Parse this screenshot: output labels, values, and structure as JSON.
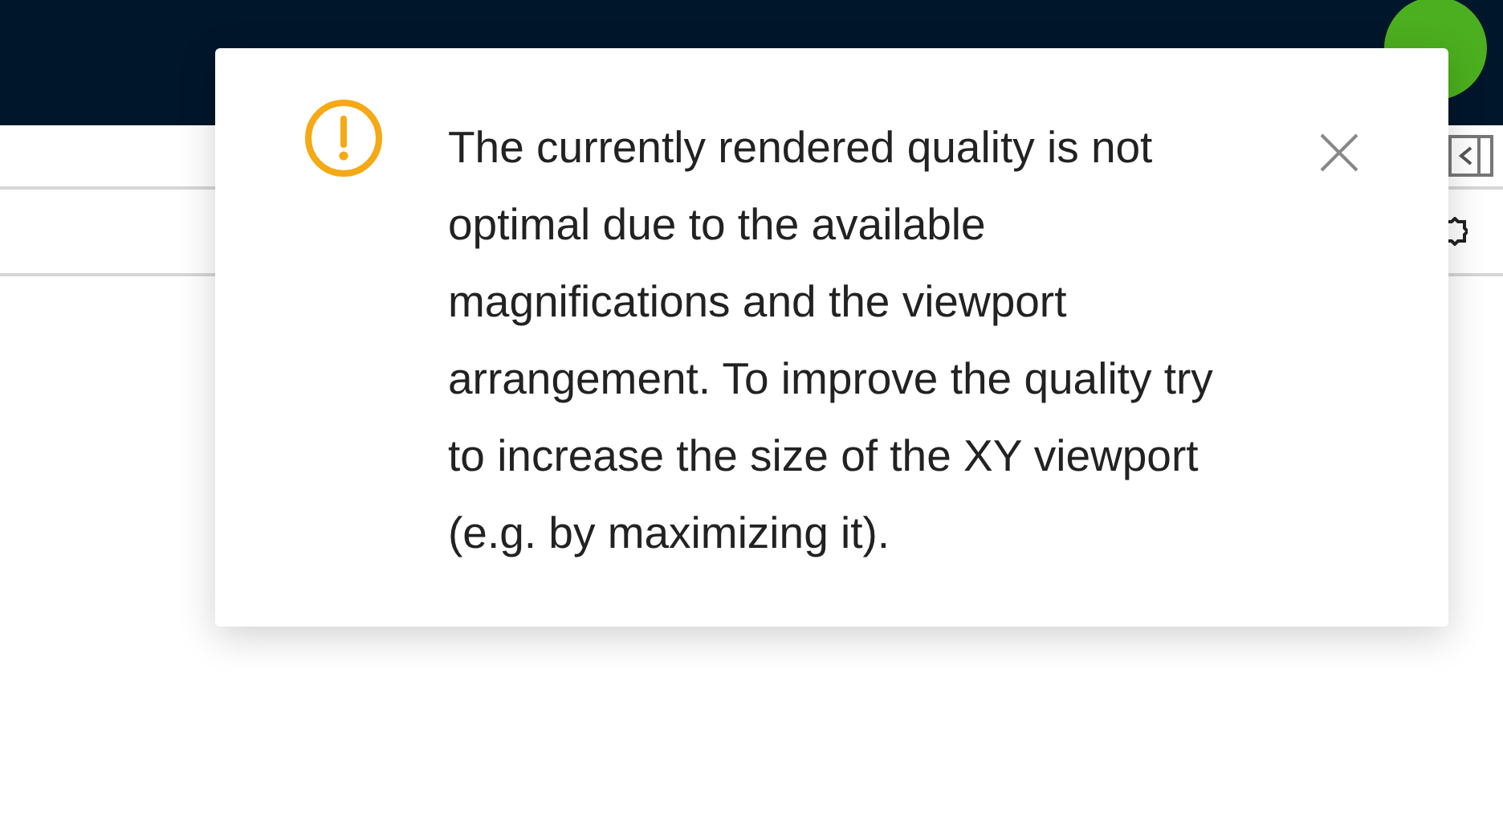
{
  "dialog": {
    "kind": "warning",
    "message": "The currently rendered quality is not optimal due to the available magnifications and the viewport arrangement. To improve the quality try to increase the size of the XY viewport (e.g. by maximizing it)."
  }
}
